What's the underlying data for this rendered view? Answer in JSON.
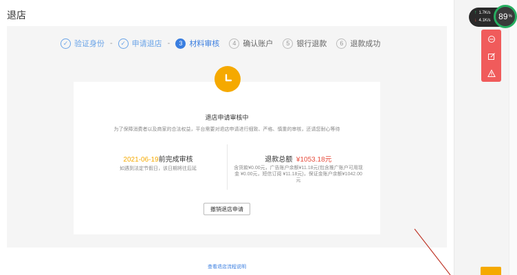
{
  "page": {
    "title": "退店"
  },
  "steps": [
    {
      "num": "✓",
      "label": "验证身份",
      "state": "done"
    },
    {
      "num": "✓",
      "label": "申请退店",
      "state": "done"
    },
    {
      "num": "3",
      "label": "材料审核",
      "state": "active"
    },
    {
      "num": "4",
      "label": "确认账户",
      "state": "todo"
    },
    {
      "num": "5",
      "label": "银行退款",
      "state": "todo"
    },
    {
      "num": "6",
      "label": "退款成功",
      "state": "todo"
    }
  ],
  "step_separator": "-",
  "card": {
    "icon": "clock-icon",
    "title": "退店申请审核中",
    "desc": "为了保障消费者以及商家的合法权益，平台需要对退店申请进行细致、严格、慎重的审核，还请您耐心等待",
    "deadline_date": "2021-06-19",
    "deadline_suffix": "前完成审核",
    "deadline_note": "如遇到法定节假日，该日期将往后延",
    "refund_label": "退款总额",
    "refund_amount": "¥1053.18元",
    "refund_detail_1": "含货款¥0.00元，广告账户余额¥11.18元(包含推广账户可用现",
    "refund_detail_2": "金 ¥0.00元，短信订阅 ¥11.18元)，保证金账户余额¥1042.00",
    "refund_detail_3": "元",
    "cancel_label": "撤销退店申请"
  },
  "process_link": "查看退店流程说明",
  "widgets": {
    "upload_speed": "1.7K/s",
    "download_speed": "4.1K/s",
    "cpu_value": "89",
    "cpu_unit": "%",
    "accent_green": "#27ae60",
    "tool_color": "#f05b5b",
    "tools": [
      "more-icon",
      "edit-icon",
      "warning-icon"
    ]
  },
  "colors": {
    "primary": "#3a7ee0",
    "warning": "#f5a900",
    "danger": "#e74c3c"
  }
}
